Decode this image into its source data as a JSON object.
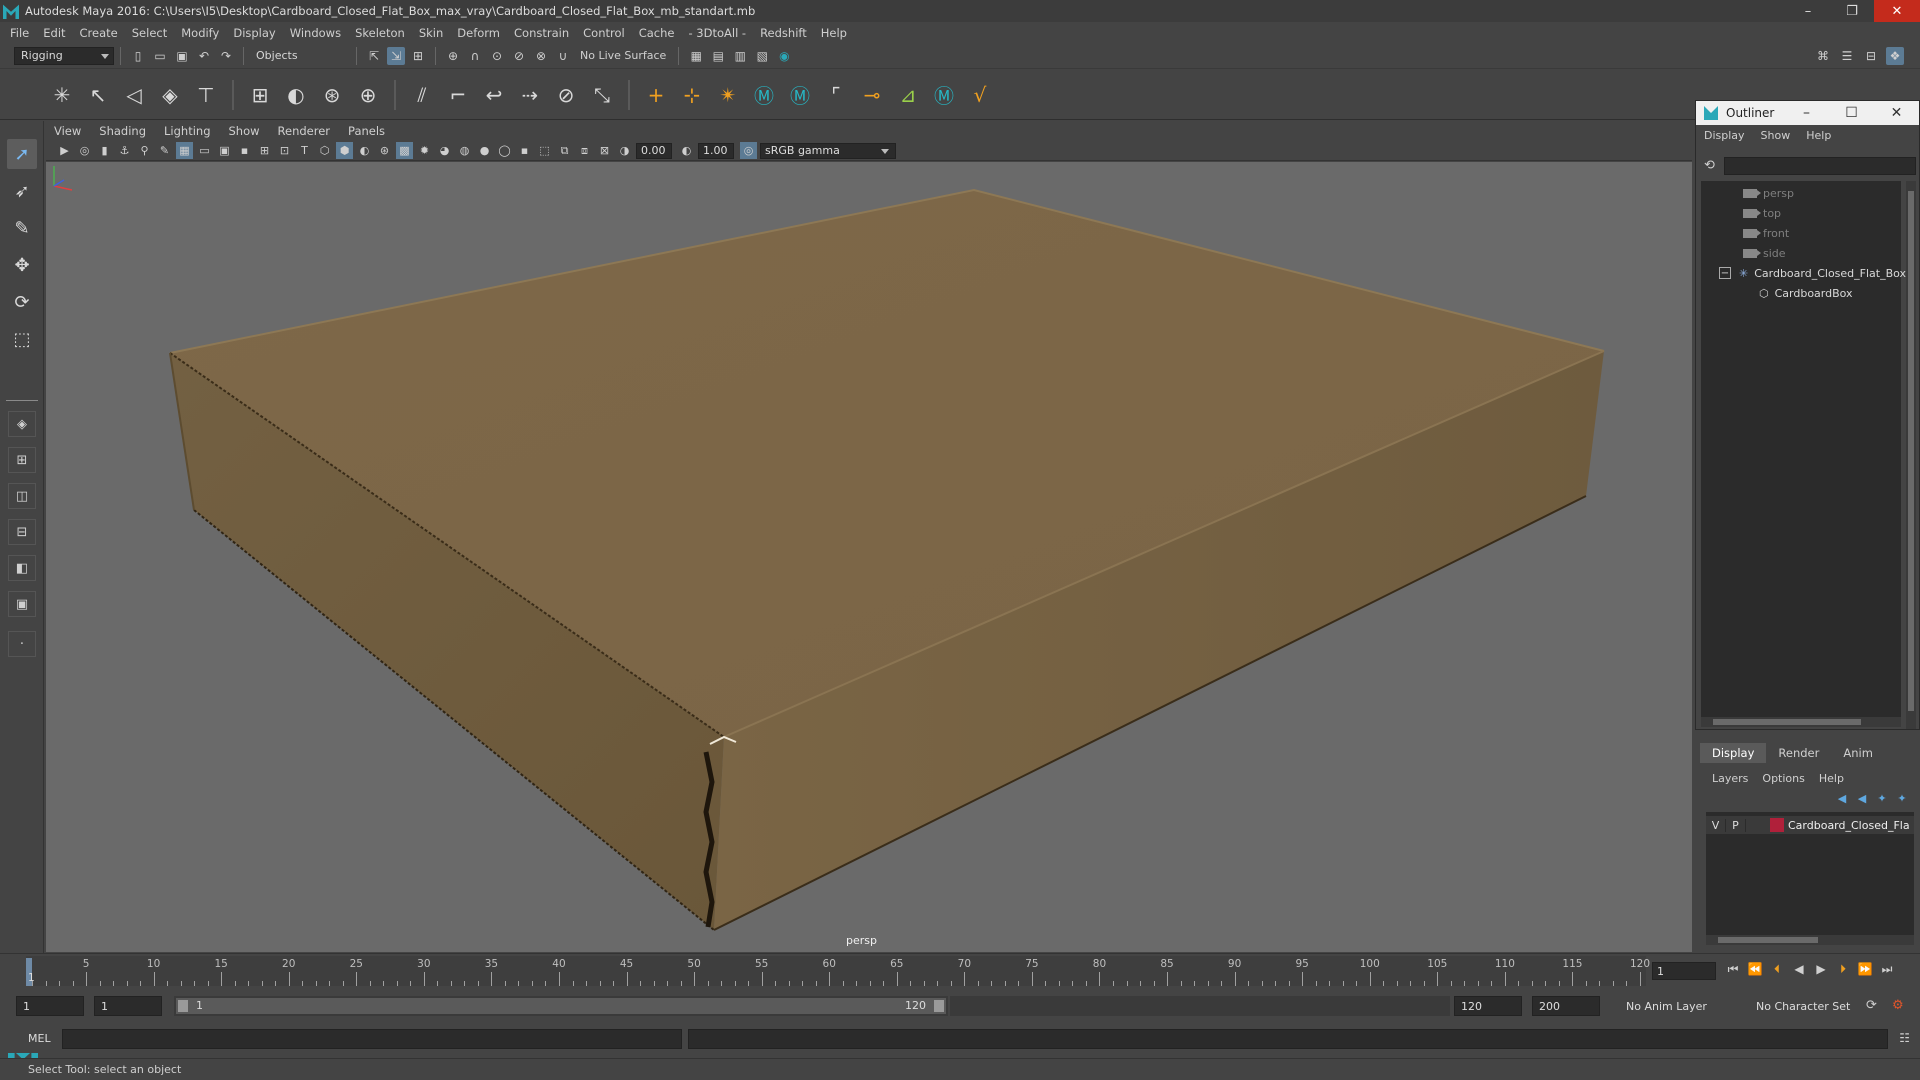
{
  "window": {
    "title": "Autodesk Maya 2016: C:\\Users\\I5\\Desktop\\Cardboard_Closed_Flat_Box_max_vray\\Cardboard_Closed_Flat_Box_mb_standart.mb",
    "minimize": "–",
    "restore": "❐",
    "close": "✕"
  },
  "menubar": [
    "File",
    "Edit",
    "Create",
    "Select",
    "Modify",
    "Display",
    "Windows",
    "Skeleton",
    "Skin",
    "Deform",
    "Constrain",
    "Control",
    "Cache",
    "- 3DtoAll -",
    "Redshift",
    "Help"
  ],
  "statusline": {
    "menu_set": "Rigging",
    "selection_mode": "Objects",
    "live_surface": "No Live Surface"
  },
  "viewport": {
    "menu": [
      "View",
      "Shading",
      "Lighting",
      "Show",
      "Renderer",
      "Panels"
    ],
    "exposure": "0.00",
    "gamma": "1.00",
    "color_space": "sRGB gamma",
    "camera_label": "persp",
    "object_color": "#7b6647"
  },
  "outliner": {
    "title": "Outliner",
    "menu": [
      "Display",
      "Show",
      "Help"
    ],
    "items": [
      {
        "label": "persp",
        "type": "camera"
      },
      {
        "label": "top",
        "type": "camera"
      },
      {
        "label": "front",
        "type": "camera"
      },
      {
        "label": "side",
        "type": "camera"
      },
      {
        "label": "Cardboard_Closed_Flat_Box",
        "type": "group"
      },
      {
        "label": "CardboardBox",
        "type": "mesh"
      }
    ]
  },
  "layers": {
    "tabs": [
      "Display",
      "Render",
      "Anim"
    ],
    "menu": [
      "Layers",
      "Options",
      "Help"
    ],
    "rows": [
      {
        "v": "V",
        "p": "P",
        "name": "Cardboard_Closed_Fla",
        "color": "#b0203a"
      }
    ]
  },
  "timeline": {
    "ticks": [
      1,
      5,
      10,
      15,
      20,
      25,
      30,
      35,
      40,
      45,
      50,
      55,
      60,
      65,
      70,
      75,
      80,
      85,
      90,
      95,
      100,
      105,
      110,
      115,
      120
    ],
    "current_frame": "1",
    "current_field": "1"
  },
  "range": {
    "start": "1",
    "playback_start": "1",
    "slider_start": "1",
    "slider_end": "120",
    "playback_end": "120",
    "end": "200",
    "anim_layer": "No Anim Layer",
    "character_set": "No Character Set"
  },
  "cmdline": {
    "language": "MEL"
  },
  "helpline": {
    "text": "Select Tool: select an object"
  }
}
